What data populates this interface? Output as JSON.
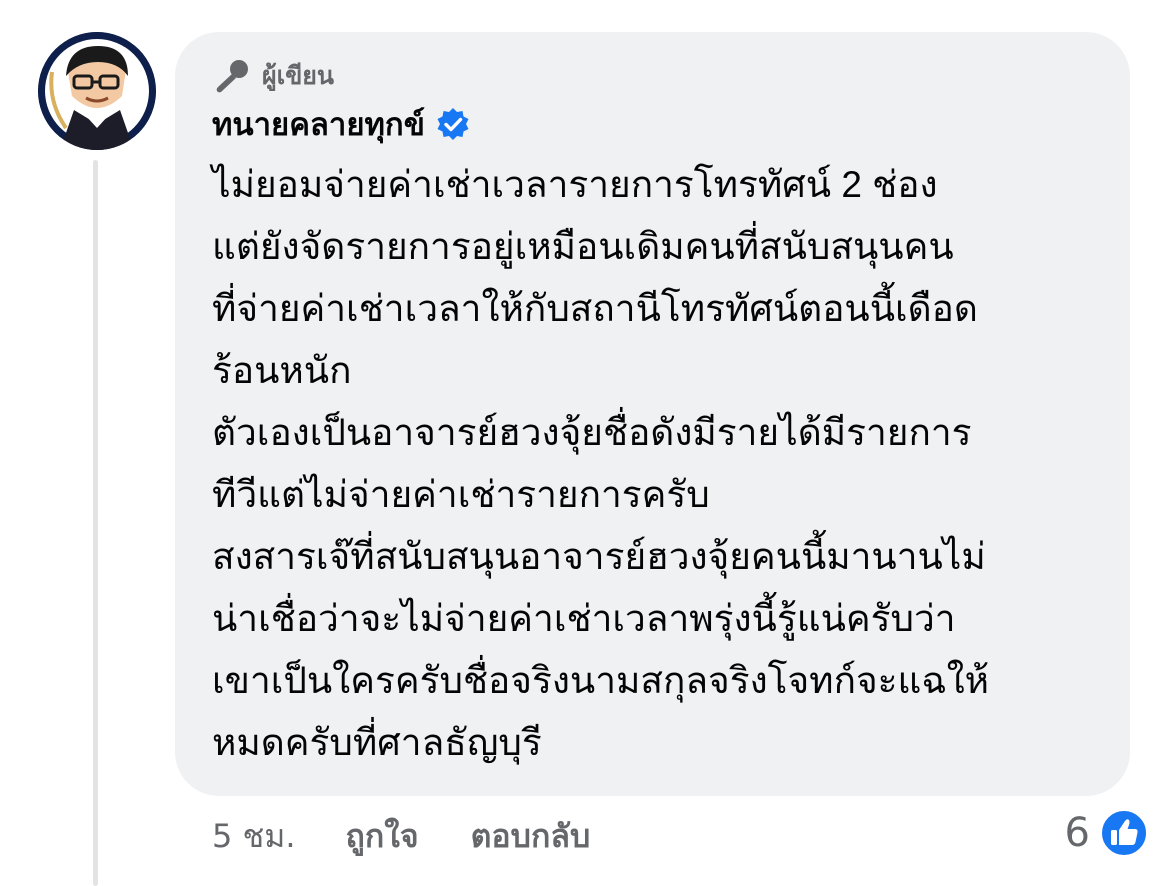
{
  "comment": {
    "author_badge": "ผู้เขียน",
    "author_name": "ทนายคลายทุกข์",
    "verified": true,
    "avatar_text": "ทนายคลายทุกข์",
    "body_lines": [
      "ไม่ยอมจ่ายค่าเช่าเวลารายการโทรทัศน์ 2 ช่อง",
      "แต่ยังจัดรายการอยู่เหมือนเดิมคนที่สนับสนุนคน",
      "ที่จ่ายค่าเช่าเวลาให้กับสถานีโทรทัศน์ตอนนี้เดือด",
      "ร้อนหนัก",
      "ตัวเองเป็นอาจารย์ฮวงจุ้ยชื่อดังมีรายได้มีรายการ",
      "ทีวีแต่ไม่จ่ายค่าเช่ารายการครับ",
      "สงสารเจ๊ที่สนับสนุนอาจารย์ฮวงจุ้ยคนนี้มานานไม่",
      "น่าเชื่อว่าจะไม่จ่ายค่าเช่าเวลาพรุ่งนี้รู้แน่ครับว่า",
      "เขาเป็นใครครับชื่อจริงนามสกุลจริงโจทก์จะแฉให้",
      "หมดครับที่ศาลธัญบุรี"
    ],
    "timestamp": "5 ชม.",
    "like_label": "ถูกใจ",
    "reply_label": "ตอบกลับ",
    "reaction_count": "6",
    "reaction_icon": "like-thumb-icon",
    "colors": {
      "bubble": "#f0f1f3",
      "meta_text": "#65676b",
      "verified_blue": "#1877f2",
      "like_blue": "#1877f2"
    }
  }
}
